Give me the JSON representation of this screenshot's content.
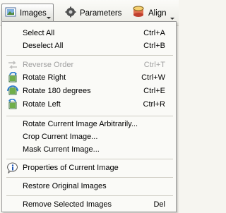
{
  "toolbar": {
    "images_label": "Images",
    "parameters_label": "Parameters",
    "align_label": "Align"
  },
  "menu": {
    "select_all": {
      "label": "Select All",
      "shortcut": "Ctrl+A"
    },
    "deselect_all": {
      "label": "Deselect All",
      "shortcut": "Ctrl+B"
    },
    "reverse_order": {
      "label": "Reverse Order",
      "shortcut": "Ctrl+T",
      "disabled": true
    },
    "rotate_right": {
      "label": "Rotate Right",
      "shortcut": "Ctrl+W",
      "icon": "rotate-right-icon"
    },
    "rotate_180": {
      "label": "Rotate 180 degrees",
      "shortcut": "Ctrl+E",
      "icon": "rotate-180-icon"
    },
    "rotate_left": {
      "label": "Rotate Left",
      "shortcut": "Ctrl+R",
      "icon": "rotate-left-icon"
    },
    "rotate_arbitrary": {
      "label": "Rotate Current Image Arbitrarily..."
    },
    "crop": {
      "label": "Crop Current Image..."
    },
    "mask": {
      "label": "Mask Current Image..."
    },
    "properties": {
      "label": "Properties of Current Image",
      "icon": "info-icon"
    },
    "restore": {
      "label": "Restore Original Images"
    },
    "remove": {
      "label": "Remove Selected Images",
      "shortcut": "Del"
    }
  }
}
